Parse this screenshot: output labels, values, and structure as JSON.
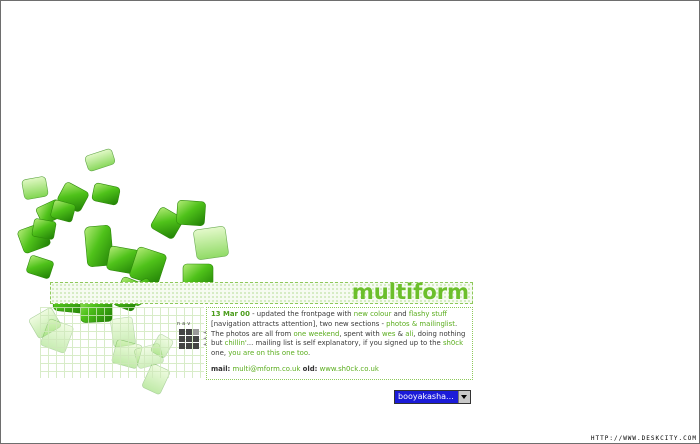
{
  "header": {
    "logo": "multiform"
  },
  "news": {
    "date": "13 Mar 00",
    "t1": " - updated the frontpage with ",
    "new_colour": "new colour",
    "t2": " and ",
    "flashy_stuff": "flashy stuff",
    "t3": " [navigation attracts attention], two new sections - ",
    "photos": "photos",
    "t4": " & ",
    "mailinglist": "mailinglist",
    "t5": ". The photos are all from ",
    "one_weekend": "one weekend",
    "t6": ", spent with ",
    "wes": "wes",
    "t7": " & ",
    "ali": "ali",
    "t8": ", doing nothing but ",
    "chillin": "chillin'",
    "t9": "... mailing list is self explanatory, if you signed up to the ",
    "sh0ck": "sh0ck",
    "t10": " one, ",
    "also_on": "you are on this one too",
    "t11": "."
  },
  "contact": {
    "mail_label": "mail:",
    "mail_value": "multi@mform.co.uk",
    "old_label": "old:",
    "old_value": "www.sh0ck.co.uk"
  },
  "nav": {
    "label": "nav",
    "side": [
      "+",
      "+",
      "+"
    ]
  },
  "select": {
    "value": "booyakasha..."
  },
  "credit": "HTTP://WWW.DESKCITY.COM",
  "colors": {
    "accent": "#6cbf2b",
    "link": "#5aad1d",
    "select_bg": "#1b1bd8"
  }
}
